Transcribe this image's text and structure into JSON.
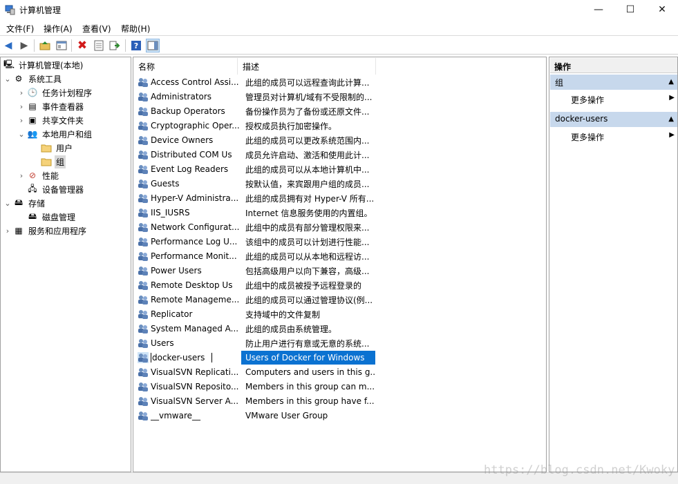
{
  "window": {
    "title": "计算机管理",
    "minimize": "—",
    "maximize": "☐",
    "close": "✕"
  },
  "menu": [
    "文件(F)",
    "操作(A)",
    "查看(V)",
    "帮助(H)"
  ],
  "tree": [
    {
      "label": "计算机管理(本地)",
      "icon": "computer-management-icon",
      "expander": ""
    },
    {
      "label": "系统工具",
      "icon": "system-tools-icon",
      "expander": "v"
    },
    {
      "label": "任务计划程序",
      "icon": "task-scheduler-icon",
      "expander": ">"
    },
    {
      "label": "事件查看器",
      "icon": "event-viewer-icon",
      "expander": ">"
    },
    {
      "label": "共享文件夹",
      "icon": "shared-folders-icon",
      "expander": ">"
    },
    {
      "label": "本地用户和组",
      "icon": "local-users-groups-icon",
      "expander": "v"
    },
    {
      "label": "用户",
      "icon": "folder-icon",
      "expander": ""
    },
    {
      "label": "组",
      "icon": "folder-open-icon",
      "expander": ""
    },
    {
      "label": "性能",
      "icon": "performance-icon",
      "expander": ">"
    },
    {
      "label": "设备管理器",
      "icon": "device-manager-icon",
      "expander": ""
    },
    {
      "label": "存储",
      "icon": "storage-icon",
      "expander": "v"
    },
    {
      "label": "磁盘管理",
      "icon": "disk-management-icon",
      "expander": ""
    },
    {
      "label": "服务和应用程序",
      "icon": "services-apps-icon",
      "expander": ">"
    }
  ],
  "columns": {
    "name": "名称",
    "desc": "描述"
  },
  "groups": [
    {
      "name": "Access Control Assi...",
      "desc": "此组的成员可以远程查询此计算..."
    },
    {
      "name": "Administrators",
      "desc": "管理员对计算机/域有不受限制的..."
    },
    {
      "name": "Backup Operators",
      "desc": "备份操作员为了备份或还原文件..."
    },
    {
      "name": "Cryptographic Oper...",
      "desc": "授权成员执行加密操作。"
    },
    {
      "name": "Device Owners",
      "desc": "此组的成员可以更改系统范围内..."
    },
    {
      "name": "Distributed COM Us",
      "desc": "成员允许启动、激活和使用此计..."
    },
    {
      "name": "Event Log Readers",
      "desc": "此组的成员可以从本地计算机中..."
    },
    {
      "name": "Guests",
      "desc": "按默认值，来宾跟用户组的成员..."
    },
    {
      "name": "Hyper-V Administra...",
      "desc": "此组的成员拥有对 Hyper-V 所有..."
    },
    {
      "name": "IIS_IUSRS",
      "desc": "Internet 信息服务使用的内置组。"
    },
    {
      "name": "Network Configurat...",
      "desc": "此组中的成员有部分管理权限来..."
    },
    {
      "name": "Performance Log U...",
      "desc": "该组中的成员可以计划进行性能..."
    },
    {
      "name": "Performance Monit...",
      "desc": "此组的成员可以从本地和远程访..."
    },
    {
      "name": "Power Users",
      "desc": "包括高级用户以向下兼容，高级..."
    },
    {
      "name": "Remote Desktop Us",
      "desc": "此组中的成员被授予远程登录的"
    },
    {
      "name": "Remote Manageme...",
      "desc": "此组的成员可以通过管理协议(例..."
    },
    {
      "name": "Replicator",
      "desc": "支持域中的文件复制"
    },
    {
      "name": "System Managed A...",
      "desc": "此组的成员由系统管理。"
    },
    {
      "name": "Users",
      "desc": "防止用户进行有意或无意的系统..."
    },
    {
      "name": "docker-users",
      "desc": "Users of Docker for Windows"
    },
    {
      "name": "VisualSVN Replicati...",
      "desc": "Computers and users in this g..."
    },
    {
      "name": "VisualSVN Reposito...",
      "desc": "Members in this group can m..."
    },
    {
      "name": "VisualSVN Server A...",
      "desc": "Members in this group have f..."
    },
    {
      "name": "__vmware__",
      "desc": "VMware User Group"
    }
  ],
  "selected_group": "docker-users",
  "actions": {
    "title": "操作",
    "sections": [
      {
        "label": "组",
        "item": "更多操作"
      },
      {
        "label": "docker-users",
        "item": "更多操作"
      }
    ]
  },
  "watermark": "https://blog.csdn.net/Kwoky",
  "colors": {
    "selection": "#0b72d1",
    "action_header": "#c7d8ec"
  }
}
